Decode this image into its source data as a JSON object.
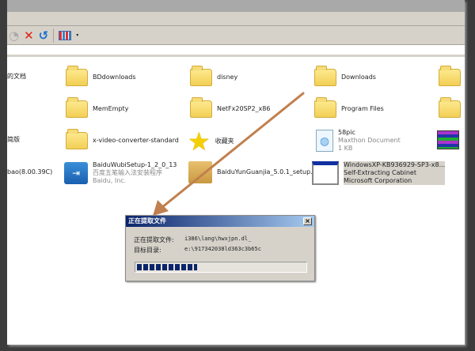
{
  "items": [
    {
      "label": "的文档"
    },
    {
      "label": "BDdownloads"
    },
    {
      "label": "disney"
    },
    {
      "label": "Downloads"
    },
    {
      "label": "MemEmpty"
    },
    {
      "label": "NetFx20SP2_x86"
    },
    {
      "label": "Program Files"
    },
    {
      "label": "简版"
    },
    {
      "label": "x-video-converter-standard"
    },
    {
      "label": "收藏夹"
    },
    {
      "label": "58pic",
      "type": "Maxthon Document",
      "size": "1 KB"
    },
    {
      "label": "bao(8.00.39C)"
    },
    {
      "label": "BaiduWubiSetup-1_2_0_13",
      "type": "百度五笔输入法安装程序",
      "company": "Baidu, Inc."
    },
    {
      "label": "BaiduYunGuanjia_5.0.1_setup..."
    },
    {
      "label": "WindowsXP-KB936929-SP3-x8...",
      "type": "Self-Extracting Cabinet",
      "company": "Microsoft Corporation"
    }
  ],
  "dialog": {
    "title": "正在提取文件",
    "close": "×",
    "file_label": "正在提取文件:",
    "file_value": "i386\\lang\\hwxjpn.dl_",
    "dir_label": "目标目录:",
    "dir_value": "e:\\917342038ld363c3b65c",
    "progress_percent": 36
  },
  "colors": {
    "arrow": "#c0804f",
    "titlebar": "#0a246a"
  }
}
